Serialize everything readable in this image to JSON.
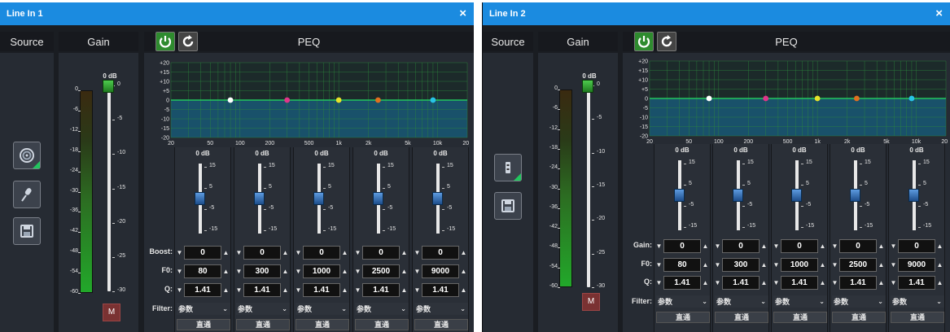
{
  "windows": [
    {
      "title": "Line In 1",
      "close": "×"
    },
    {
      "title": "Line In 2",
      "close": "×"
    }
  ],
  "headers": {
    "source": "Source",
    "gain": "Gain",
    "peq": "PEQ"
  },
  "icons": {
    "power": "power-icon",
    "reset": "refresh-icon",
    "speaker": "speaker-icon",
    "mic": "microphone-icon",
    "save": "save-icon",
    "port": "port-icon"
  },
  "colors": {
    "titlebar": "#1b8be0",
    "graph_fill": "#19516a",
    "grid": "#2d8a3c",
    "gain_meter": "#22a82a",
    "mute": "#7a3232"
  },
  "gain": {
    "value_label": "0 dB",
    "value_db": 0,
    "meter_scale": [
      "0",
      "-6",
      "-12",
      "-18",
      "-24",
      "-30",
      "-36",
      "-42",
      "-48",
      "-54",
      "-60"
    ],
    "fader_scale": [
      "0",
      "-5",
      "-10",
      "-15",
      "-20",
      "-25",
      "-30"
    ],
    "mute_label": "M"
  },
  "graph": {
    "y_labels": [
      "+20",
      "+15",
      "+10",
      "+5",
      "0",
      "-5",
      "-10",
      "-15",
      "-20"
    ],
    "x_labels": [
      "20",
      "50",
      "100",
      "200",
      "500",
      "1k",
      "2k",
      "5k",
      "10k",
      "20k"
    ]
  },
  "chart_data": {
    "type": "line",
    "title": "PEQ",
    "x_scale": "log",
    "xlim": [
      20,
      20000
    ],
    "ylim": [
      -20,
      20
    ],
    "xlabel": "",
    "ylabel": "",
    "series": [
      {
        "values": [
          [
            20,
            0
          ],
          [
            20000,
            0
          ]
        ]
      }
    ],
    "points": [
      {
        "x": 80,
        "y": 0,
        "color": "#ffffff"
      },
      {
        "x": 300,
        "y": 0,
        "color": "#e0358a"
      },
      {
        "x": 1000,
        "y": 0,
        "color": "#e8e22a"
      },
      {
        "x": 2500,
        "y": 0,
        "color": "#e0701f"
      },
      {
        "x": 9000,
        "y": 0,
        "color": "#27c3e6"
      }
    ],
    "grid": true
  },
  "band_scale": [
    "15",
    "5",
    "-5",
    "-15"
  ],
  "bands": [
    {
      "db_label": "0 dB",
      "gain": "0",
      "f0": "80",
      "q": "1.41",
      "filter": "参数",
      "bypass": "直通"
    },
    {
      "db_label": "0 dB",
      "gain": "0",
      "f0": "300",
      "q": "1.41",
      "filter": "参数",
      "bypass": "直通"
    },
    {
      "db_label": "0 dB",
      "gain": "0",
      "f0": "1000",
      "q": "1.41",
      "filter": "参数",
      "bypass": "直通"
    },
    {
      "db_label": "0 dB",
      "gain": "0",
      "f0": "2500",
      "q": "1.41",
      "filter": "参数",
      "bypass": "直通"
    },
    {
      "db_label": "0 dB",
      "gain": "0",
      "f0": "9000",
      "q": "1.41",
      "filter": "参数",
      "bypass": "直通"
    }
  ],
  "param_labels": {
    "w1": {
      "gain": "Boost:",
      "f0": "F0:",
      "q": "Q:",
      "filter": "Filter:"
    },
    "w2": {
      "gain": "Gain:",
      "f0": "F0:",
      "q": "Q:",
      "filter": "Filter:"
    }
  },
  "symbols": {
    "down": "▼",
    "up": "▲",
    "chevron": "⌄"
  }
}
